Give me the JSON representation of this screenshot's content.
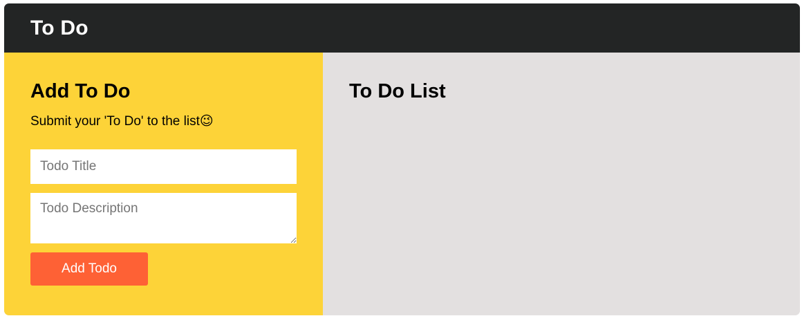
{
  "header": {
    "title": "To Do"
  },
  "add_panel": {
    "heading": "Add To Do",
    "subtitle": "Submit your 'To Do' to the list😉",
    "title_input": {
      "value": "",
      "placeholder": "Todo Title"
    },
    "description_input": {
      "value": "",
      "placeholder": "Todo Description"
    },
    "submit_label": "Add Todo"
  },
  "list_panel": {
    "heading": "To Do List",
    "items": []
  },
  "colors": {
    "header_bg": "#232525",
    "add_panel_bg": "#fdd338",
    "list_panel_bg": "#e3e0e0",
    "button_bg": "#fe6135"
  }
}
